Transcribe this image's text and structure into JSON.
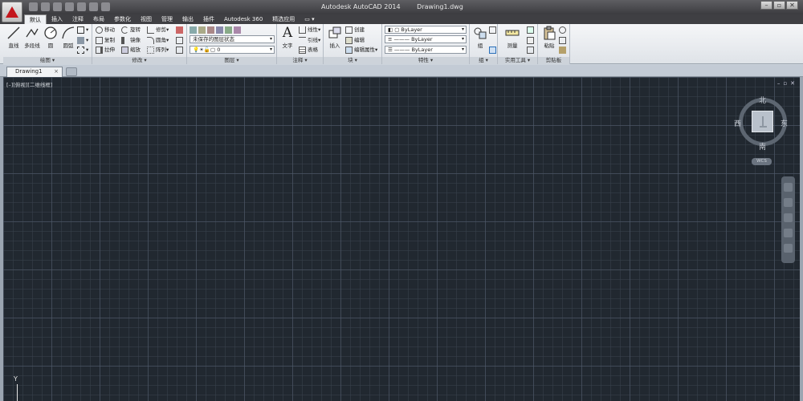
{
  "window": {
    "app_title": "Autodesk AutoCAD 2014",
    "document_title": "Drawing1.dwg",
    "controls": [
      "–",
      "▫",
      "✕"
    ]
  },
  "ribbon_tabs": [
    "默认",
    "插入",
    "注释",
    "布局",
    "参数化",
    "视图",
    "管理",
    "输出",
    "插件",
    "Autodesk 360",
    "精选应用"
  ],
  "active_tab": "默认",
  "panels": {
    "draw": {
      "label": "绘图 ▾",
      "buttons": [
        "直线",
        "多段线",
        "圆",
        "圆弧"
      ]
    },
    "modify": {
      "label": "修改 ▾",
      "rows": [
        [
          "移动",
          "旋转",
          "修剪"
        ],
        [
          "复制",
          "镜像",
          "圆角"
        ],
        [
          "拉伸",
          "缩放",
          "阵列"
        ]
      ]
    },
    "layers": {
      "label": "图层 ▾",
      "layer_state": "未保存的图层状态",
      "current_layer": "0"
    },
    "annotation": {
      "label": "注释 ▾",
      "text_button": "文字",
      "items": [
        "线性",
        "引线",
        "表格"
      ]
    },
    "block": {
      "label": "块 ▾",
      "insert_button": "插入",
      "items": [
        "创建",
        "编辑",
        "编辑属性"
      ]
    },
    "properties": {
      "label": "特性 ▾",
      "color": "ByLayer",
      "linetype": "ByLayer",
      "lineweight": "ByLayer"
    },
    "groups": {
      "label": "组 ▾",
      "button": "组"
    },
    "utilities": {
      "label": "实用工具 ▾",
      "button": "测量"
    },
    "clipboard": {
      "label": "剪贴板",
      "button": "粘贴"
    }
  },
  "file_tab": {
    "name": "Drawing1",
    "close": "×"
  },
  "viewport": {
    "control_label": "[–][俯视][二维线框]",
    "win_buttons": [
      "–",
      "▫",
      "✕"
    ]
  },
  "viewcube": {
    "north": "北",
    "south": "南",
    "east": "东",
    "west": "西",
    "wcs": "WCS"
  },
  "ucs": {
    "y_label": "Y"
  },
  "colors": {
    "canvas_bg": "#212830",
    "title_bar": "#3b3b3f",
    "ribbon_bg": "#eef0f3",
    "logo_red": "#c4161c"
  }
}
